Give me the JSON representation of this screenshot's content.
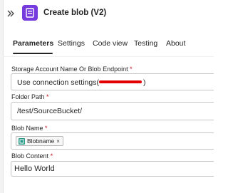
{
  "header": {
    "title": "Create blob (V2)",
    "icon": "azure-blob-storage-icon",
    "icon_color": "#773adc"
  },
  "tabs": [
    {
      "label": "Parameters",
      "active": true
    },
    {
      "label": "Settings",
      "active": false
    },
    {
      "label": "Code view",
      "active": false
    },
    {
      "label": "Testing",
      "active": false
    },
    {
      "label": "About",
      "active": false
    }
  ],
  "fields": {
    "storage_account": {
      "label": "Storage Account Name Or Blob Endpoint",
      "required_mark": "*",
      "value_prefix": "Use connection settings(",
      "value_suffix": ")"
    },
    "folder_path": {
      "label": "Folder Path",
      "required_mark": "*",
      "value": "/test/SourceBucket/"
    },
    "blob_name": {
      "label": "Blob Name",
      "required_mark": "*",
      "token_label": "Blobname",
      "token_remove": "×"
    },
    "blob_content": {
      "label": "Blob Content",
      "required_mark": "*",
      "value": "Hello World"
    }
  },
  "colors": {
    "required": "#c50f1f",
    "redaction": "#e30000",
    "token_icon": "#2b9b8a"
  }
}
